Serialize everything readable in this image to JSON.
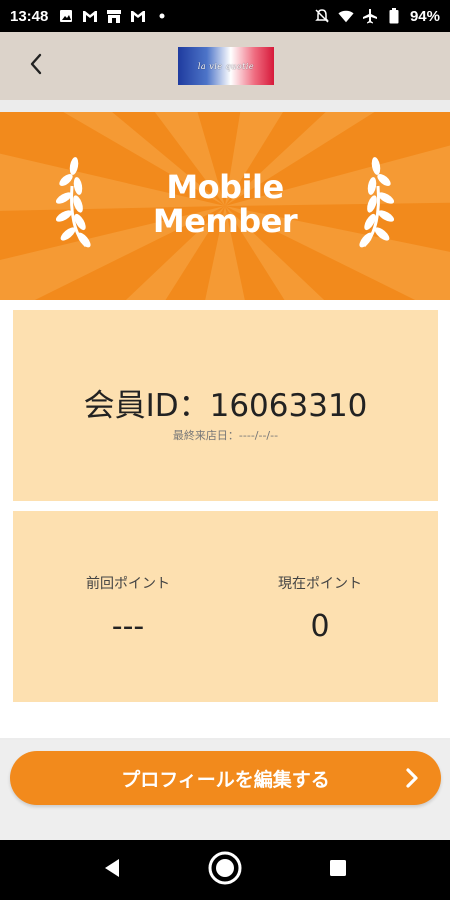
{
  "status_bar": {
    "time": "13:48",
    "battery": "94%",
    "left_icons": [
      "image-icon",
      "gmail-icon",
      "store-icon",
      "gmail-icon",
      "dot-icon"
    ],
    "right_icons": [
      "mute-icon",
      "wifi-icon",
      "airplane-icon",
      "battery-icon"
    ]
  },
  "app_bar": {
    "back_icon": "chevron-left-icon",
    "logo_text": "la vie quotie"
  },
  "banner": {
    "title_line1": "Mobile",
    "title_line2": "Member",
    "accent_color": "#f28a1c"
  },
  "member_card": {
    "id_label": "会員ID：",
    "id_value": "16063310",
    "last_visit": "最終来店日：----/--/--"
  },
  "points_card": {
    "previous_label": "前回ポイント",
    "previous_value": "---",
    "current_label": "現在ポイント",
    "current_value": "0"
  },
  "edit_profile": {
    "label": "プロフィールを編集する",
    "icon": "chevron-right-icon"
  },
  "nav_bar": {
    "buttons": [
      "back-triangle-icon",
      "home-circle-icon",
      "recents-square-icon"
    ]
  }
}
